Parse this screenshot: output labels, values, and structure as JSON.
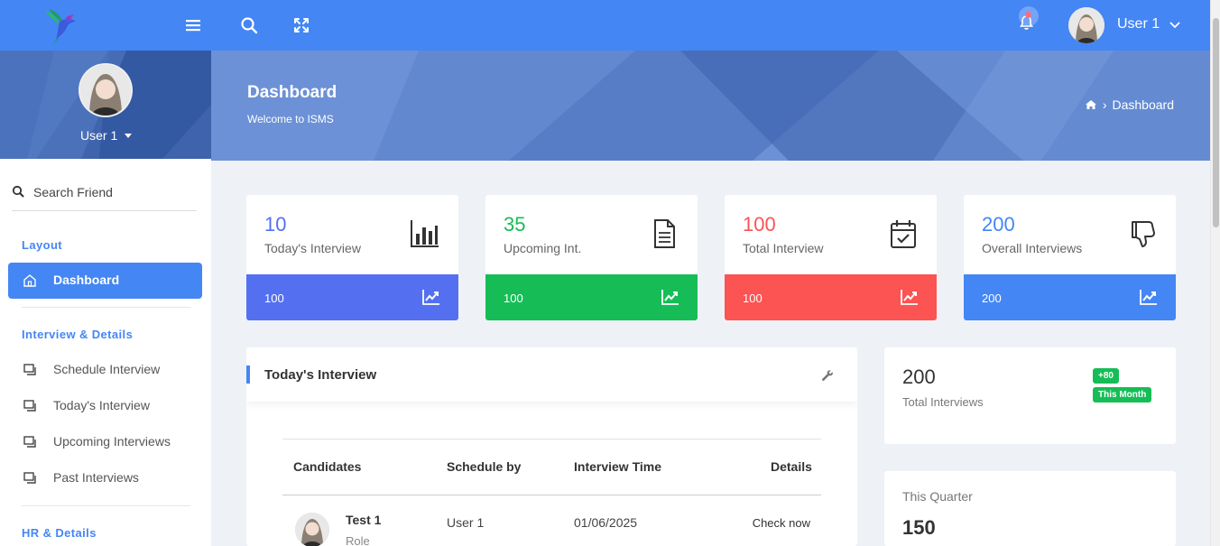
{
  "topbar": {
    "user_name": "User 1",
    "icons": [
      "logo-bird",
      "menu-icon",
      "search-icon",
      "fullscreen-icon",
      "bell-icon",
      "chevron-down-icon"
    ]
  },
  "sidebar": {
    "profile_name": "User 1",
    "search_label": "Search Friend",
    "sections": [
      {
        "title": "Layout",
        "items": [
          {
            "label": "Dashboard",
            "active": true,
            "icon": "home-icon"
          }
        ]
      },
      {
        "title": "Interview & Details",
        "items": [
          {
            "label": "Schedule Interview",
            "icon": "window-icon"
          },
          {
            "label": "Today's Interview",
            "icon": "window-icon"
          },
          {
            "label": "Upcoming Interviews",
            "icon": "window-icon"
          },
          {
            "label": "Past Interviews",
            "icon": "window-icon"
          }
        ]
      },
      {
        "title": "HR & Details",
        "items": []
      }
    ]
  },
  "banner": {
    "title": "Dashboard",
    "subtitle": "Welcome to ISMS",
    "breadcrumb": {
      "separator": "›",
      "current": "Dashboard"
    }
  },
  "stats": [
    {
      "value": "10",
      "label": "Today's Interview",
      "footer_value": "100",
      "accent": "#5470f1",
      "icon": "bar-chart-icon"
    },
    {
      "value": "35",
      "label": "Upcoming Int.",
      "footer_value": "100",
      "accent": "#16bd56",
      "icon": "document-icon"
    },
    {
      "value": "100",
      "label": "Total Interview",
      "footer_value": "100",
      "accent": "#fc5353",
      "icon": "calendar-check-icon"
    },
    {
      "value": "200",
      "label": "Overall Interviews",
      "footer_value": "200",
      "accent": "#4486f4",
      "icon": "thumbs-down-icon"
    }
  ],
  "todays_panel": {
    "title": "Today's Interview",
    "columns": [
      "Candidates",
      "Schedule by",
      "Interview Time",
      "Details"
    ],
    "rows": [
      {
        "candidate": "Test 1",
        "role": "Role",
        "scheduled_by": "User 1",
        "time": "01/06/2025",
        "details": "Check now"
      }
    ]
  },
  "total_card": {
    "value": "200",
    "label": "Total Interviews",
    "badge_top": "+80",
    "badge_bottom": "This Month"
  },
  "quarter_card": {
    "label": "This Quarter",
    "value": "150"
  },
  "colors": {
    "primary": "#4486f4",
    "banner": "#6c91d6",
    "profile_bg": "#3f63ad",
    "green": "#16bd56",
    "red": "#fc5353",
    "indigo": "#5470f1"
  }
}
